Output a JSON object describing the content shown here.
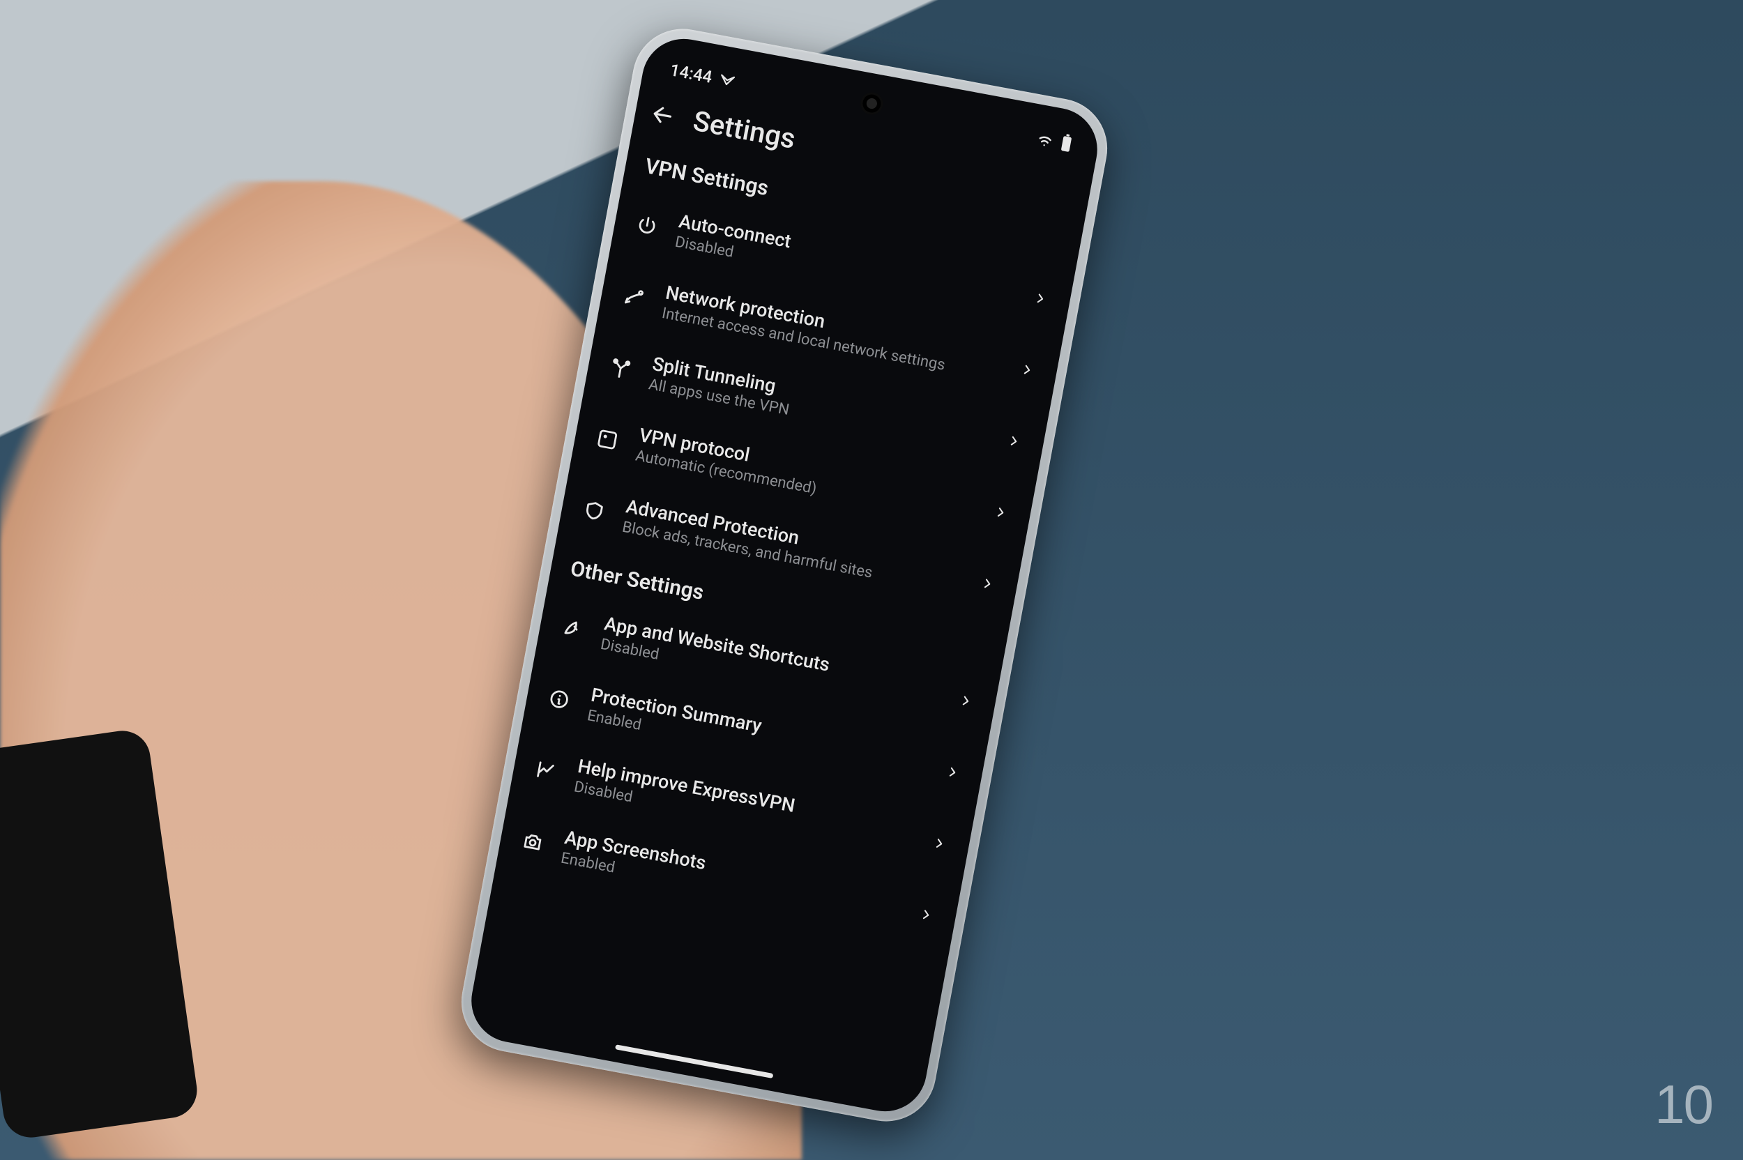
{
  "watermark": "10",
  "statusbar": {
    "time": "14:44"
  },
  "header": {
    "title": "Settings"
  },
  "sections": [
    {
      "title": "VPN Settings",
      "items": [
        {
          "icon": "power-icon",
          "title": "Auto-connect",
          "subtitle": "Disabled"
        },
        {
          "icon": "network-icon",
          "title": "Network protection",
          "subtitle": "Internet access and local network settings"
        },
        {
          "icon": "split-icon",
          "title": "Split Tunneling",
          "subtitle": "All apps use the VPN"
        },
        {
          "icon": "protocol-icon",
          "title": "VPN protocol",
          "subtitle": "Automatic (recommended)"
        },
        {
          "icon": "shield-icon",
          "title": "Advanced Protection",
          "subtitle": "Block ads, trackers, and harmful sites"
        }
      ]
    },
    {
      "title": "Other Settings",
      "items": [
        {
          "icon": "rocket-icon",
          "title": "App and Website Shortcuts",
          "subtitle": "Disabled"
        },
        {
          "icon": "info-icon",
          "title": "Protection Summary",
          "subtitle": "Enabled"
        },
        {
          "icon": "chart-icon",
          "title": "Help improve ExpressVPN",
          "subtitle": "Disabled"
        },
        {
          "icon": "camera-icon",
          "title": "App Screenshots",
          "subtitle": "Enabled"
        }
      ]
    }
  ]
}
